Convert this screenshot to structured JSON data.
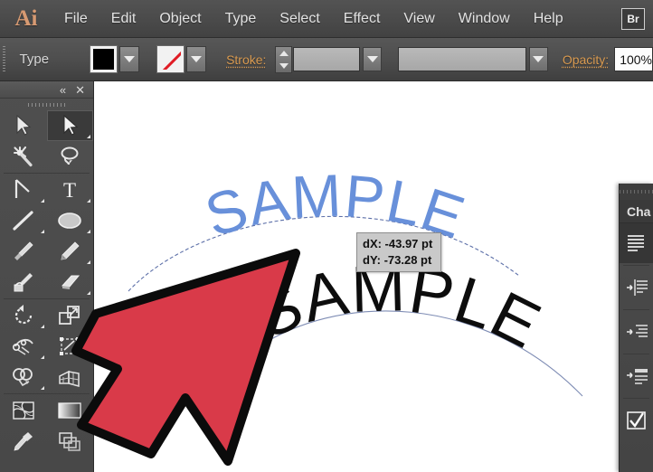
{
  "app": {
    "name": "Adobe Illustrator",
    "logo_text": "Ai",
    "bridge_button_label": "Br"
  },
  "menubar": {
    "items": [
      {
        "label": "File",
        "name": "menu-file"
      },
      {
        "label": "Edit",
        "name": "menu-edit"
      },
      {
        "label": "Object",
        "name": "menu-object"
      },
      {
        "label": "Type",
        "name": "menu-type"
      },
      {
        "label": "Select",
        "name": "menu-select"
      },
      {
        "label": "Effect",
        "name": "menu-effect"
      },
      {
        "label": "View",
        "name": "menu-view"
      },
      {
        "label": "Window",
        "name": "menu-window"
      },
      {
        "label": "Help",
        "name": "menu-help"
      }
    ]
  },
  "control_bar": {
    "context_label": "Type",
    "fill_swatch_color": "#000000",
    "stroke_swatch_value": "None",
    "stroke_label": "Stroke:",
    "stroke_weight_value": "",
    "stroke_profile_value": "",
    "opacity_label": "Opacity:",
    "opacity_value": "100%"
  },
  "toolbar": {
    "collapse_icon": "«",
    "close_icon": "✕",
    "tools": [
      {
        "name": "selection-tool",
        "label": "Selection Tool",
        "selected": false,
        "has_flyout": false
      },
      {
        "name": "direct-selection-tool",
        "label": "Direct Selection Tool",
        "selected": true,
        "has_flyout": true
      },
      {
        "name": "magic-wand-tool",
        "label": "Magic Wand Tool",
        "selected": false,
        "has_flyout": false
      },
      {
        "name": "lasso-tool",
        "label": "Lasso Tool",
        "selected": false,
        "has_flyout": false
      },
      {
        "name": "pen-tool",
        "label": "Pen Tool",
        "selected": false,
        "has_flyout": true
      },
      {
        "name": "type-tool",
        "label": "Type Tool",
        "selected": false,
        "has_flyout": true
      },
      {
        "name": "line-segment-tool",
        "label": "Line Segment Tool",
        "selected": false,
        "has_flyout": true
      },
      {
        "name": "ellipse-tool",
        "label": "Ellipse Tool",
        "selected": false,
        "has_flyout": true
      },
      {
        "name": "paintbrush-tool",
        "label": "Paintbrush Tool",
        "selected": false,
        "has_flyout": false
      },
      {
        "name": "pencil-tool",
        "label": "Pencil Tool",
        "selected": false,
        "has_flyout": true
      },
      {
        "name": "blob-brush-tool",
        "label": "Blob Brush Tool",
        "selected": false,
        "has_flyout": false
      },
      {
        "name": "eraser-tool",
        "label": "Eraser Tool",
        "selected": false,
        "has_flyout": true
      },
      {
        "name": "rotate-tool",
        "label": "Rotate Tool",
        "selected": false,
        "has_flyout": true
      },
      {
        "name": "scale-tool",
        "label": "Scale Tool",
        "selected": false,
        "has_flyout": true
      },
      {
        "name": "width-tool",
        "label": "Width Tool",
        "selected": false,
        "has_flyout": true
      },
      {
        "name": "free-transform-tool",
        "label": "Free Transform Tool",
        "selected": false,
        "has_flyout": false
      },
      {
        "name": "shape-builder-tool",
        "label": "Shape Builder Tool",
        "selected": false,
        "has_flyout": true
      },
      {
        "name": "perspective-grid-tool",
        "label": "Perspective Grid Tool",
        "selected": false,
        "has_flyout": false
      },
      {
        "name": "mesh-tool",
        "label": "Mesh Tool",
        "selected": false,
        "has_flyout": false
      },
      {
        "name": "gradient-tool",
        "label": "Gradient Tool",
        "selected": false,
        "has_flyout": false
      },
      {
        "name": "eyedropper-tool",
        "label": "Eyedropper Tool",
        "selected": false,
        "has_flyout": false
      },
      {
        "name": "blend-tool",
        "label": "Blend Tool",
        "selected": false,
        "has_flyout": false
      }
    ]
  },
  "right_panel": {
    "tab_label": "Cha",
    "rows": [
      {
        "name": "paragraph-align-left",
        "label": "Align left",
        "selected": true
      },
      {
        "name": "paragraph-indent-left",
        "label": "Indent left margin",
        "selected": false
      },
      {
        "name": "paragraph-indent-right",
        "label": "Indent right margin",
        "selected": false
      },
      {
        "name": "paragraph-space-before",
        "label": "Space before paragraph",
        "selected": false
      },
      {
        "name": "hyphenate-checkbox",
        "label": "Hyphenate",
        "selected": false
      }
    ]
  },
  "canvas": {
    "background_color": "#ffffff",
    "objects": [
      {
        "name": "type-on-path-blue",
        "text": "SAMPLE",
        "color": "#6890da",
        "on_path": true,
        "path_style": "dashed-arc",
        "description": "Blue SAMPLE text set on a curved (arc) path, being dragged"
      },
      {
        "name": "type-on-path-black",
        "text": "SAMPLE",
        "color": "#0d0d0d",
        "on_path": true,
        "path_style": "solid-arc",
        "description": "Black SAMPLE text set on a lower arc path"
      }
    ]
  },
  "tooltip": {
    "name": "drag-delta-tooltip",
    "lines": [
      "dX: -43.97 pt",
      "dY: -73.28 pt"
    ],
    "dx_label": "dX:",
    "dx_value": "-43.97 pt",
    "dy_label": "dY:",
    "dy_value": "-73.28 pt",
    "background_color": "#c9c9c9"
  },
  "cursor": {
    "name": "illustrated-arrow-cursor",
    "fill_color": "#d93a49",
    "stroke_color": "#0a0a0a",
    "direction": "up-right"
  }
}
